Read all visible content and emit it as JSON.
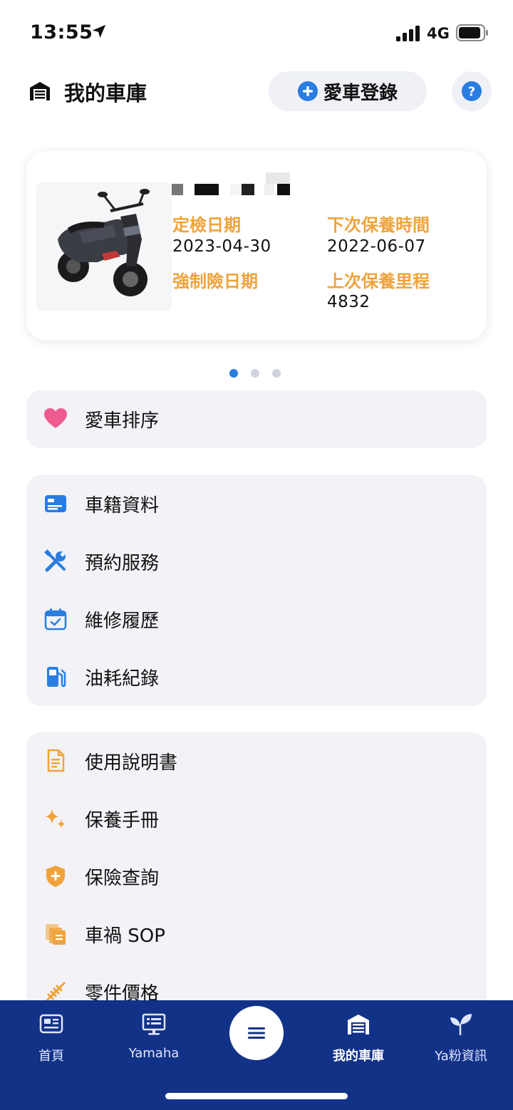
{
  "status_bar": {
    "time": "13:55",
    "network": "4G"
  },
  "header": {
    "title": "我的車庫",
    "add_vehicle_label": "愛車登錄"
  },
  "vehicle_card": {
    "inspection_date_label": "定檢日期",
    "inspection_date": "2023-04-30",
    "insurance_date_label": "強制險日期",
    "insurance_date": "",
    "next_maintenance_label": "下次保養時間",
    "next_maintenance": "2022-06-07",
    "last_mileage_label": "上次保養里程",
    "last_mileage": "4832"
  },
  "carousel": {
    "page_count": 3,
    "active_index": 0
  },
  "menu": {
    "sort": "愛車排序",
    "registration": "車籍資料",
    "booking": "預約服務",
    "repair_history": "維修履歷",
    "fuel_log": "油耗紀錄",
    "manual": "使用說明書",
    "maintenance_book": "保養手冊",
    "insurance_query": "保險查詢",
    "accident_sop": "車禍 SOP",
    "parts_price": "零件價格"
  },
  "tabs": {
    "home": "首頁",
    "yamaha": "Yamaha",
    "garage": "我的車庫",
    "fan_info": "Ya粉資訊"
  },
  "colors": {
    "accent_blue": "#2a7de1",
    "label_orange": "#f0a33a",
    "tabbar_navy": "#123288",
    "heart_pink": "#ee5b8f"
  }
}
